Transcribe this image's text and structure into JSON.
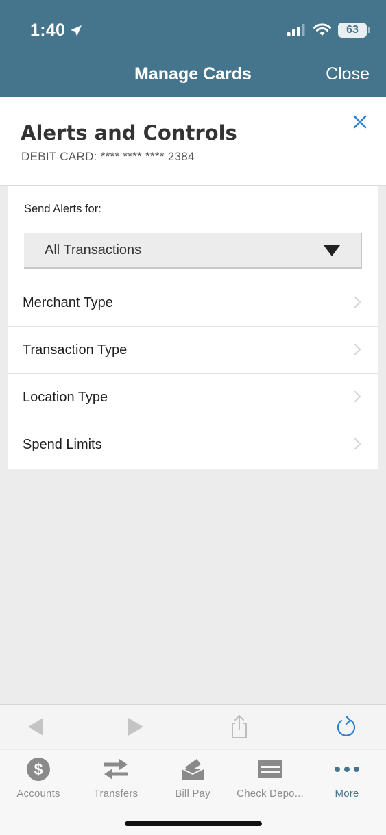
{
  "status_bar": {
    "time": "1:40",
    "battery": "63"
  },
  "nav": {
    "title": "Manage Cards",
    "close_label": "Close"
  },
  "panel": {
    "title": "Alerts and Controls",
    "card_label": "DEBIT CARD: **** **** **** 2384"
  },
  "alerts": {
    "label": "Send Alerts for:",
    "selected": "All Transactions"
  },
  "menu": [
    {
      "label": "Merchant Type"
    },
    {
      "label": "Transaction Type"
    },
    {
      "label": "Location Type"
    },
    {
      "label": "Spend Limits"
    }
  ],
  "tabs": [
    {
      "label": "Accounts",
      "icon": "dollar-icon"
    },
    {
      "label": "Transfers",
      "icon": "transfer-arrows-icon"
    },
    {
      "label": "Bill Pay",
      "icon": "bill-pay-icon"
    },
    {
      "label": "Check Depo...",
      "icon": "check-deposit-icon"
    },
    {
      "label": "More",
      "icon": "more-dots-icon",
      "active": true
    }
  ],
  "colors": {
    "header": "#44758c",
    "accent": "#2a7fd4",
    "active_tab": "#44758c"
  }
}
